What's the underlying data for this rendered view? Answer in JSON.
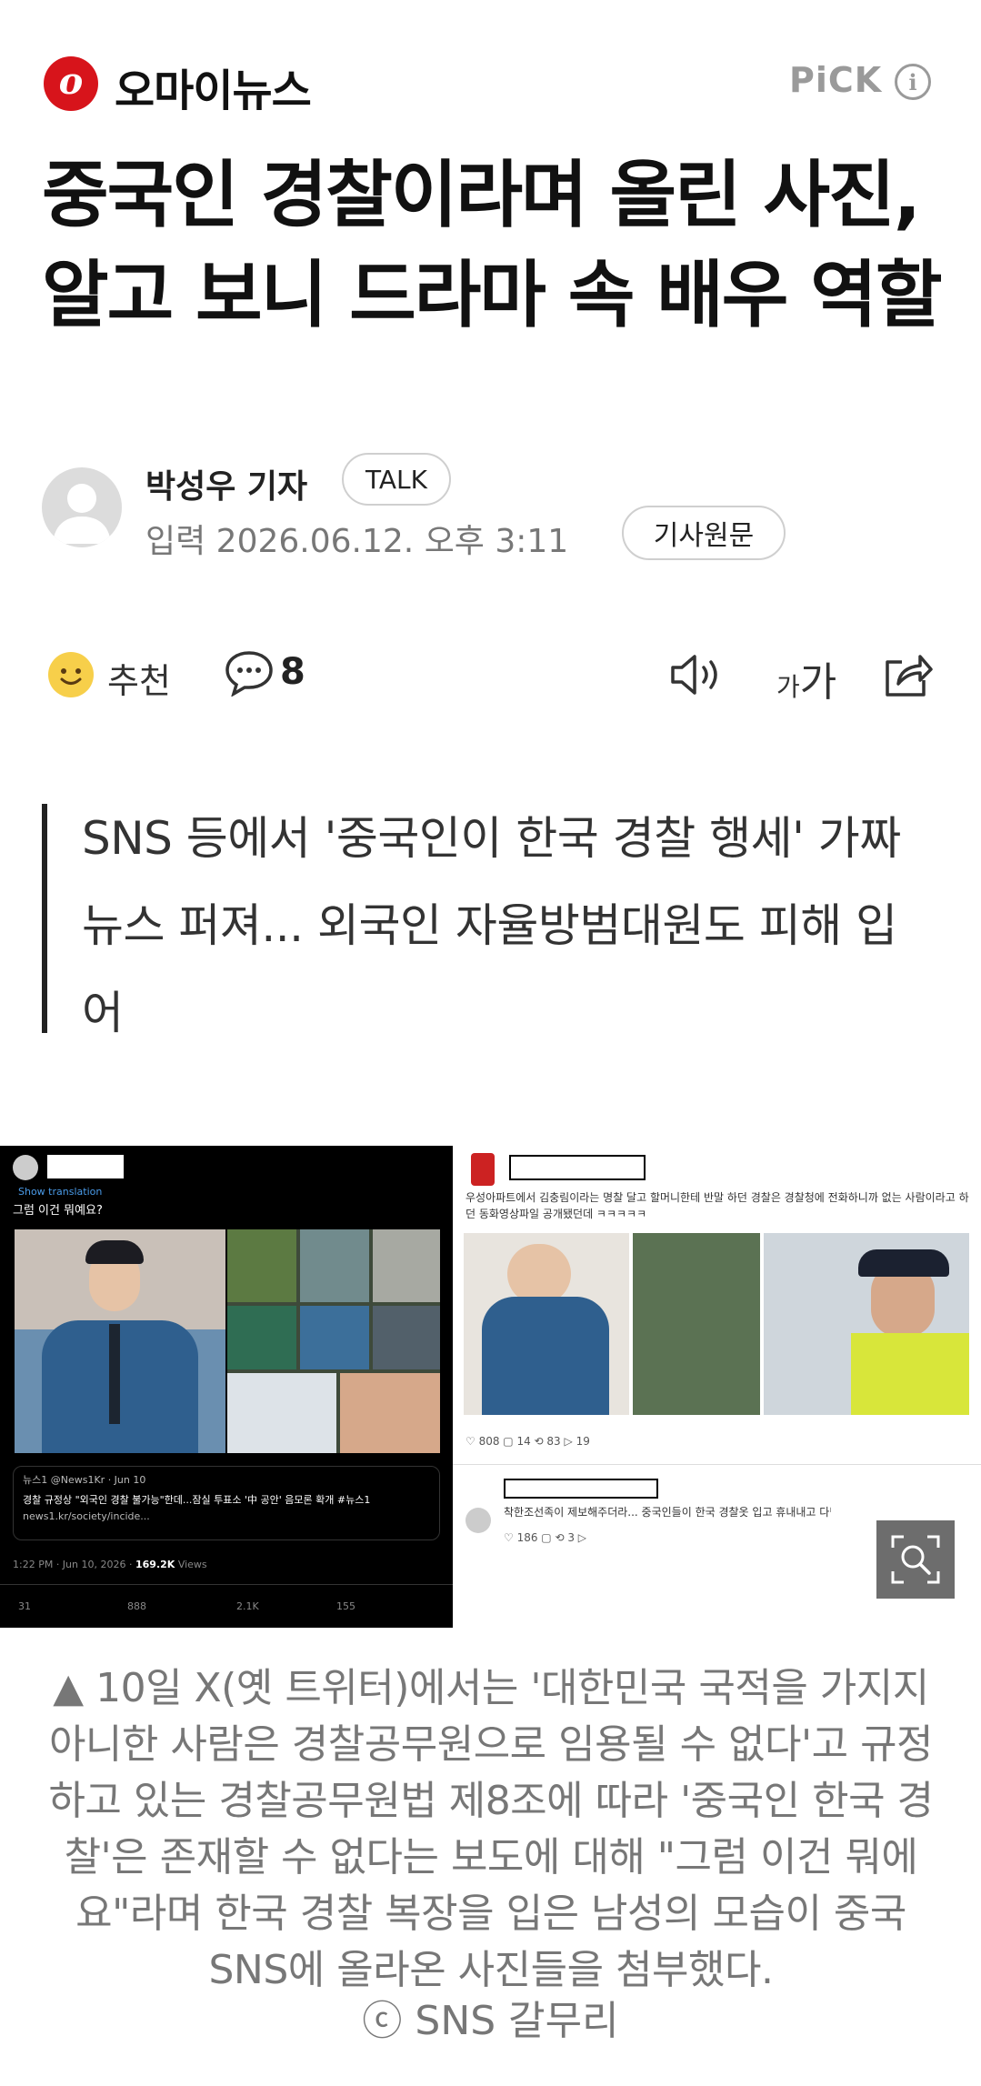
{
  "header": {
    "logo_letter": "o",
    "brand": "오마이뉴스",
    "pick_label": "PiCK",
    "info_glyph": "i"
  },
  "article": {
    "title": "중국인 경찰이라며 올린 사진, 알고 보니 드라마 속 배우 역할",
    "reporter": "박성우 기자",
    "talk_label": "TALK",
    "date": "입력 2026.06.12. 오후 3:11",
    "original_label": "기사원문"
  },
  "actions": {
    "recommend_label": "추천",
    "comment_count": "8",
    "font_small": "가",
    "font_big": "가"
  },
  "subtitle": "SNS 등에서 '중국인이 한국 경찰 행세' 가짜뉴스 퍼져... 외국인 자율방범대원도 피해 입어",
  "photo": {
    "left_post": {
      "show_translation": "Show translation",
      "question": "그럼 이건 뭐예요?",
      "quote_source": "뉴스1 @News1Kr · Jun 10",
      "quote_headline": "경찰 규정상 \"외국인 경찰 불가능\"한데...잠실 투표소 '中 공안' 음모론 확개 #뉴스1",
      "quote_link": "news1.kr/society/incide...",
      "timestamp": "1:22 PM · Jun 10, 2026 · ",
      "views": "169.2K",
      "views_label": "Views",
      "stats": [
        "31",
        "888",
        "2.1K",
        "155"
      ]
    },
    "right_post": {
      "text": "우성아파트에서 김충림이라는 명찰 달고 할머니한테 반말 하던 경찰은 경찰청에 전화하니까 없는 사람이라고 하던 동화영상파일 공개됐던데 ㅋㅋㅋㅋㅋ",
      "stats": [
        "808",
        "14",
        "83",
        "19"
      ],
      "reply_text": "착한조선족이 제보해주더라... 중국인들이 한국 경찰옷 입고 휴내내고 다닌다고.",
      "reply_stats": [
        "186",
        "3"
      ]
    }
  },
  "caption": "▲ 10일 X(옛 트위터)에서는 '대한민국 국적을 가지지 아니한 사람은 경찰공무원으로 임용될 수 없다'고 규정하고 있는 경찰공무원법 제8조에 따라 '중국인 한국 경찰'은 존재할 수 없다는 보도에 대해 \"그럼 이건 뭐에요\"라며 한국 경찰 복장을 입은 남성의 모습이 중국 SNS에 올라온 사진들을 첨부했다.",
  "credit": "ⓒ SNS 갈무리",
  "colors": {
    "brand_red": "#d7141b",
    "text_gray": "#777777",
    "pick_gray": "#9a9a9a"
  }
}
